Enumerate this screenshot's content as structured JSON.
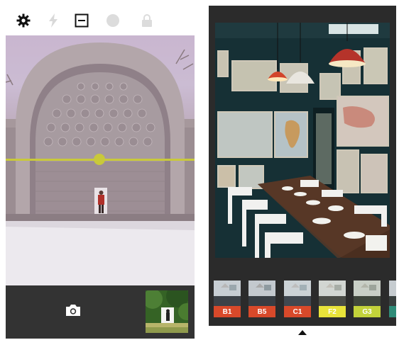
{
  "camera": {
    "toolbar": {
      "settings_icon": "gear-icon",
      "flash_icon": "flash-icon",
      "level_icon": "level-icon",
      "focus_icon": "circle-icon",
      "lock_icon": "lock-icon"
    },
    "level_color": "#c9c93a",
    "shutter_icon": "camera-icon"
  },
  "filters": {
    "items": [
      {
        "label": "B1",
        "color": "#d8492a"
      },
      {
        "label": "B5",
        "color": "#d8492a"
      },
      {
        "label": "C1",
        "color": "#d8492a"
      },
      {
        "label": "F2",
        "color": "#e9e43a"
      },
      {
        "label": "G3",
        "color": "#c3d33a"
      }
    ],
    "partial_color": "#2f8c78"
  }
}
